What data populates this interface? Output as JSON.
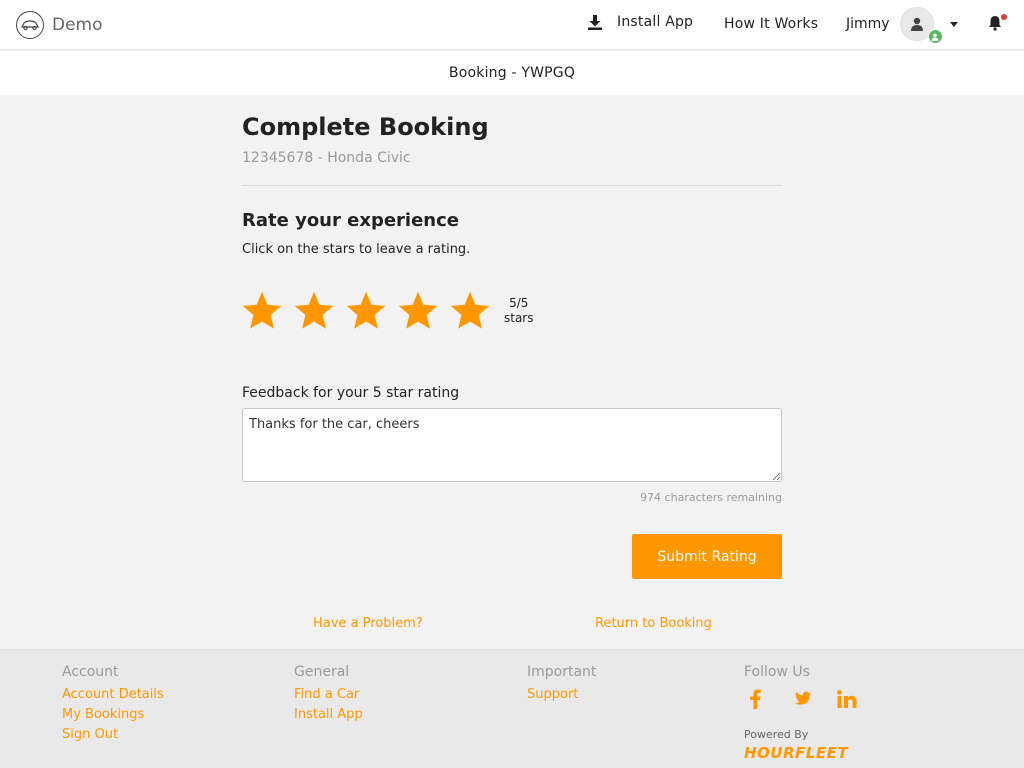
{
  "header": {
    "brand": "Demo",
    "nav": {
      "install_app": "Install App",
      "how_it_works": "How It Works",
      "user_name": "Jimmy"
    }
  },
  "subheader": {
    "title": "Booking - YWPGQ"
  },
  "main": {
    "title": "Complete Booking",
    "subtitle": "12345678 - Honda Civic",
    "rate_title": "Rate your experience",
    "rate_hint": "Click on the stars to leave a rating.",
    "rating": {
      "value": 5,
      "max": 5,
      "readout": "5/5",
      "unit": "stars"
    },
    "feedback_label": "Feedback for your 5 star rating",
    "feedback_value": "Thanks for the car, cheers",
    "chars_remaining": "974 characters remaining",
    "submit_label": "Submit Rating",
    "link_problem": "Have a Problem?",
    "link_return": "Return to Booking"
  },
  "footer": {
    "account": {
      "heading": "Account",
      "links": [
        "Account Details",
        "My Bookings",
        "Sign Out"
      ]
    },
    "general": {
      "heading": "General",
      "links": [
        "Find a Car",
        "Install App"
      ]
    },
    "important": {
      "heading": "Important",
      "links": [
        "Support"
      ]
    },
    "follow": {
      "heading": "Follow Us",
      "icons": [
        "facebook-icon",
        "twitter-icon",
        "linkedin-icon"
      ]
    },
    "powered_by": "Powered By",
    "powered_logo": "HOURFLEET"
  },
  "colors": {
    "accent": "#ff9800",
    "status_online": "#5cb85c",
    "notification_dot": "#e53935"
  }
}
